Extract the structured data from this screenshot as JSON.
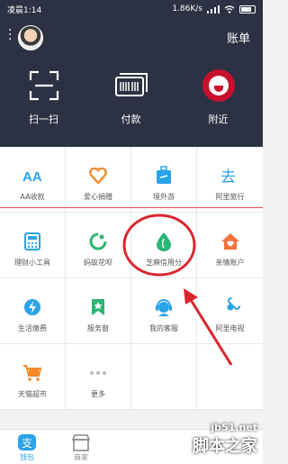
{
  "status_bar": {
    "carrier_time": "凌晨1:14",
    "speed": "1.86K/s"
  },
  "header": {
    "bill_label": "账单",
    "quick_actions": [
      {
        "label": "扫一扫",
        "icon": "scan-icon"
      },
      {
        "label": "付款",
        "icon": "barcode-icon"
      },
      {
        "label": "附近",
        "icon": "kfc-logo-icon"
      }
    ]
  },
  "grid": {
    "rows": [
      [
        {
          "label": "AA收款",
          "icon": "aa-icon",
          "color": "#2aa3e8"
        },
        {
          "label": "爱心捐赠",
          "icon": "heart-icon",
          "color": "#f28a2a"
        },
        {
          "label": "境外游",
          "icon": "suitcase-icon",
          "color": "#2aa3e8"
        },
        {
          "label": "阿里旅行",
          "icon": "travel-icon",
          "color": "#2aa3e8"
        }
      ],
      [
        {
          "label": "理财小工具",
          "icon": "calculator-icon",
          "color": "#2aa3e8"
        },
        {
          "label": "蚂蚁花呗",
          "icon": "huabei-icon",
          "color": "#2bb673"
        },
        {
          "label": "芝麻信用分",
          "icon": "sesame-icon",
          "color": "#2bb673"
        },
        {
          "label": "亲情账户",
          "icon": "family-icon",
          "color": "#f2703a"
        }
      ],
      [
        {
          "label": "生活缴费",
          "icon": "lightning-icon",
          "color": "#2aa3e8"
        },
        {
          "label": "服务窗",
          "icon": "bookmark-icon",
          "color": "#2bb673"
        },
        {
          "label": "我的客服",
          "icon": "customer-service-icon",
          "color": "#2aa3e8"
        },
        {
          "label": "阿里电视",
          "icon": "tv-icon",
          "color": "#2aa3e8"
        }
      ],
      [
        {
          "label": "天猫超市",
          "icon": "cart-icon",
          "color": "#f28a2a"
        },
        {
          "label": "更多",
          "icon": "more-icon",
          "color": "#bbbbbb"
        }
      ]
    ]
  },
  "bottom_tabs": [
    {
      "label": "钱包",
      "icon": "wallet-icon",
      "color": "#2aa3e8"
    },
    {
      "label": "商家",
      "icon": "shop-icon",
      "color": "#888888"
    }
  ],
  "watermark": {
    "line1": "jb51.net",
    "line2": "脚本之家"
  }
}
